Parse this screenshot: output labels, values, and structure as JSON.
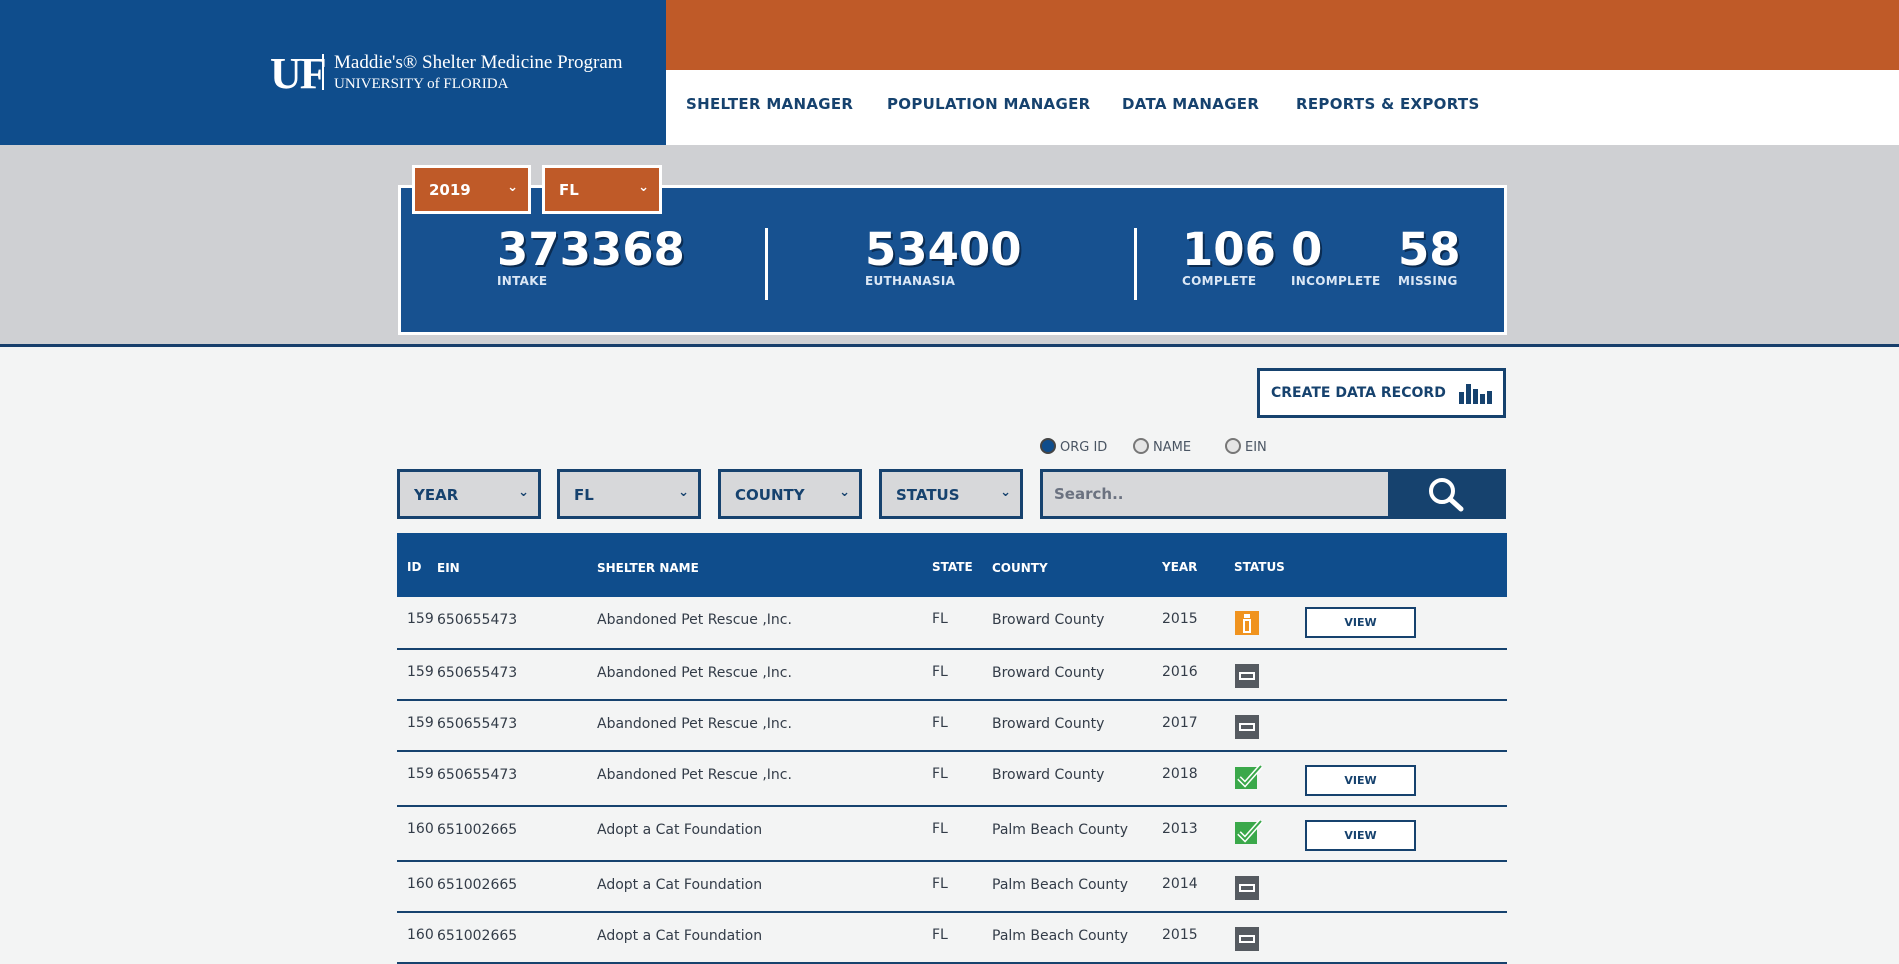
{
  "brand": {
    "logo": "UF",
    "line1": "Maddie's® Shelter Medicine Program",
    "line2": "UNIVERSITY of FLORIDA"
  },
  "nav": [
    {
      "label": "SHELTER MANAGER"
    },
    {
      "label": "POPULATION MANAGER"
    },
    {
      "label": "DATA MANAGER"
    },
    {
      "label": "REPORTS & EXPORTS"
    }
  ],
  "summary": {
    "year_select": "2019",
    "state_select": "FL",
    "intake": {
      "value": "373368",
      "label": "INTAKE"
    },
    "euthanasia": {
      "value": "53400",
      "label": "EUTHANASIA"
    },
    "complete": {
      "value": "106",
      "label": "COMPLETE"
    },
    "incomplete": {
      "value": "0",
      "label": "INCOMPLETE"
    },
    "missing": {
      "value": "58",
      "label": "MISSING"
    }
  },
  "create_button": "CREATE DATA RECORD",
  "search_mode": {
    "options": [
      "ORG ID",
      "NAME",
      "EIN"
    ],
    "selected": "ORG ID"
  },
  "filters": {
    "year": "YEAR",
    "state": "FL",
    "county": "COUNTY",
    "status": "STATUS"
  },
  "search": {
    "placeholder": "Search.."
  },
  "table": {
    "headers": {
      "id": "ID",
      "ein": "EIN",
      "name": "SHELTER NAME",
      "state": "STATE",
      "county": "COUNTY",
      "year": "YEAR",
      "status": "STATUS"
    },
    "view_label": "VIEW",
    "rows": [
      {
        "id": "159",
        "ein": "650655473",
        "name": "Abandoned Pet Rescue ,Inc.",
        "state": "FL",
        "county": "Broward County",
        "year": "2015",
        "status": "incomplete",
        "view": true
      },
      {
        "id": "159",
        "ein": "650655473",
        "name": "Abandoned Pet Rescue ,Inc.",
        "state": "FL",
        "county": "Broward County",
        "year": "2016",
        "status": "missing",
        "view": false
      },
      {
        "id": "159",
        "ein": "650655473",
        "name": "Abandoned Pet Rescue ,Inc.",
        "state": "FL",
        "county": "Broward County",
        "year": "2017",
        "status": "missing",
        "view": false
      },
      {
        "id": "159",
        "ein": "650655473",
        "name": "Abandoned Pet Rescue ,Inc.",
        "state": "FL",
        "county": "Broward County",
        "year": "2018",
        "status": "complete",
        "view": true
      },
      {
        "id": "160",
        "ein": "651002665",
        "name": "Adopt a Cat Foundation",
        "state": "FL",
        "county": "Palm Beach County",
        "year": "2013",
        "status": "complete",
        "view": true
      },
      {
        "id": "160",
        "ein": "651002665",
        "name": "Adopt a Cat Foundation",
        "state": "FL",
        "county": "Palm Beach County",
        "year": "2014",
        "status": "missing",
        "view": false
      },
      {
        "id": "160",
        "ein": "651002665",
        "name": "Adopt a Cat Foundation",
        "state": "FL",
        "county": "Palm Beach County",
        "year": "2015",
        "status": "missing",
        "view": false
      }
    ]
  },
  "colors": {
    "brand_blue": "#0f4d8c",
    "brand_orange": "#bf5a28",
    "status_complete": "#3aa84a",
    "status_incomplete": "#f0931e",
    "status_missing": "#555a60"
  }
}
